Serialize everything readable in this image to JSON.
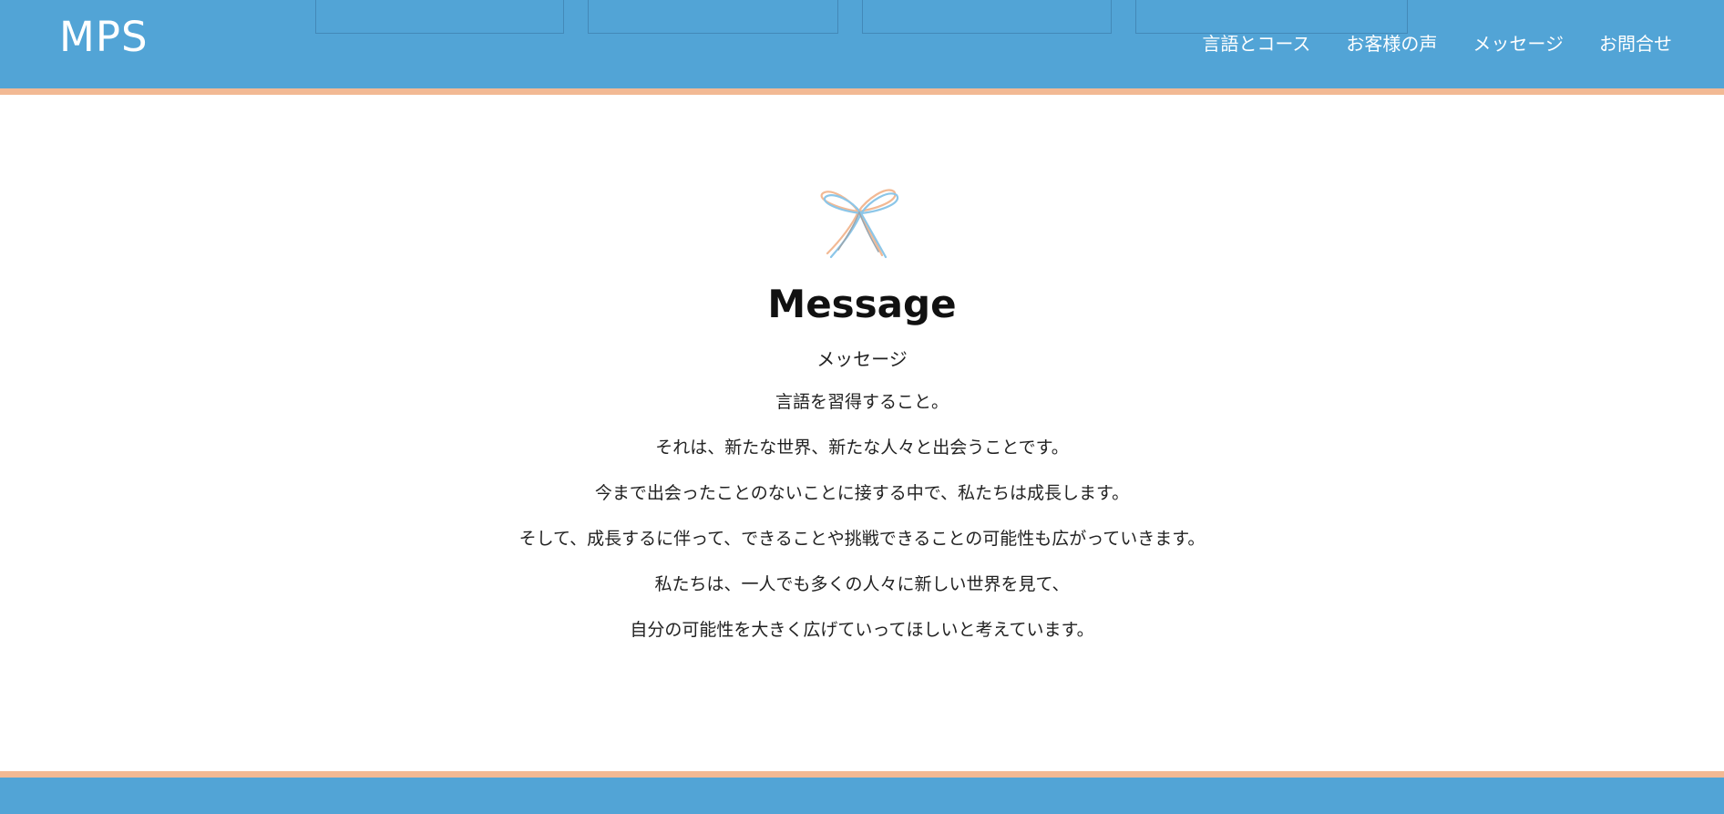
{
  "header": {
    "logo": "MPS",
    "nav": [
      {
        "label": "言語とコース"
      },
      {
        "label": "お客様の声"
      },
      {
        "label": "メッセージ"
      },
      {
        "label": "お問合せ"
      }
    ]
  },
  "main": {
    "icon": "ribbon-bow-icon",
    "title": "Message",
    "subtitle": "メッセージ",
    "lines": [
      "言語を習得すること。",
      "それは、新たな世界、新たな人々と出会うことです。",
      "今まで出会ったことのないことに接する中で、私たちは成長します。",
      "そして、成長するに伴って、できることや挑戦できることの可能性も広がっていきます。",
      "私たちは、一人でも多くの人々に新しい世界を見て、",
      "自分の可能性を大きく広げていってほしいと考えています。"
    ]
  },
  "colors": {
    "primary": "#52a4d6",
    "accent": "#f2b994",
    "text": "#222222",
    "background": "#ffffff"
  }
}
